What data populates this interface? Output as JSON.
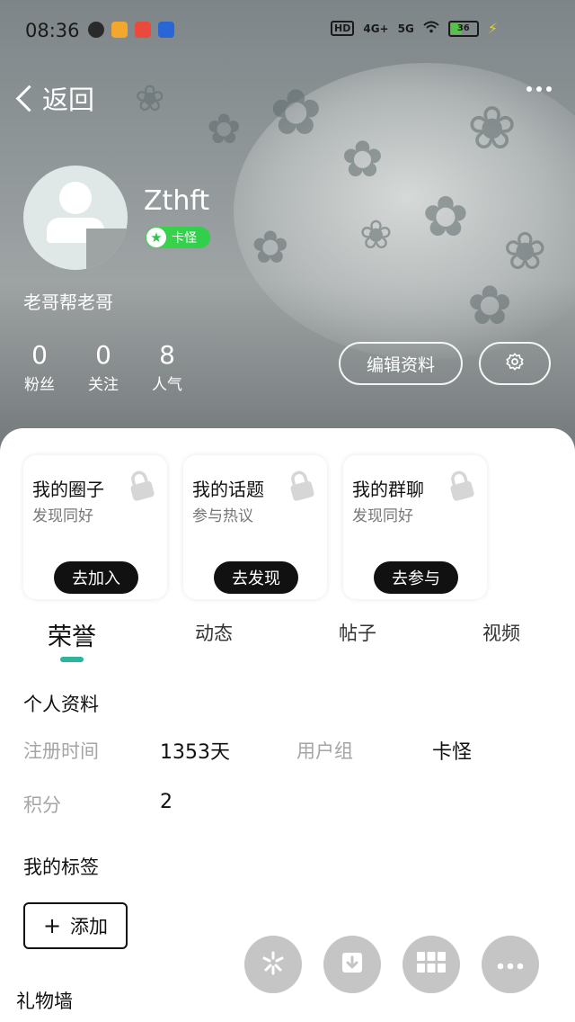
{
  "status_bar": {
    "time": "08:36",
    "hd": "HD",
    "net1": "4G+",
    "net2": "5G",
    "battery": "36"
  },
  "nav": {
    "back_label": "返回"
  },
  "profile": {
    "username": "Zthft",
    "level": "卡怪",
    "bio": "老哥帮老哥",
    "stats": [
      {
        "value": "0",
        "label": "粉丝"
      },
      {
        "value": "0",
        "label": "关注"
      },
      {
        "value": "8",
        "label": "人气"
      }
    ],
    "edit_label": "编辑资料"
  },
  "cards": [
    {
      "title": "我的圈子",
      "subtitle": "发现同好",
      "button": "去加入"
    },
    {
      "title": "我的话题",
      "subtitle": "参与热议",
      "button": "去发现"
    },
    {
      "title": "我的群聊",
      "subtitle": "发现同好",
      "button": "去参与"
    }
  ],
  "tabs": [
    "荣誉",
    "动态",
    "帖子",
    "视频"
  ],
  "personal_info": {
    "title": "个人资料",
    "register_label": "注册时间",
    "register_value": "1353天",
    "group_label": "用户组",
    "group_value": "卡怪",
    "points_label": "积分",
    "points_value": "2"
  },
  "tags": {
    "title": "我的标签",
    "add_label": "添加"
  },
  "gift_wall": {
    "title": "礼物墙"
  },
  "colors": {
    "accent": "#2cb59c",
    "badge_green": "#2ed04b",
    "dark_button": "#111111"
  }
}
